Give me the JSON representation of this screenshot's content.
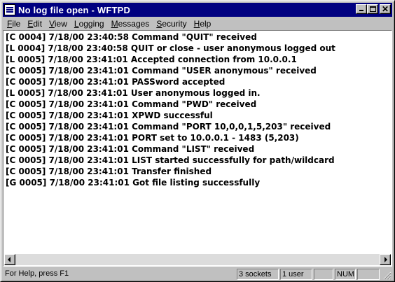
{
  "window": {
    "title": "No log file open - WFTPD"
  },
  "menu": [
    "File",
    "Edit",
    "View",
    "Logging",
    "Messages",
    "Security",
    "Help"
  ],
  "menu_underline": [
    "F",
    "E",
    "V",
    "L",
    "M",
    "S",
    "H"
  ],
  "log": [
    "[C 0004] 7/18/00 23:40:58 Command \"QUIT\" received",
    "[L 0004] 7/18/00 23:40:58 QUIT or close - user anonymous logged out",
    "[L 0005] 7/18/00 23:41:01 Accepted connection from 10.0.0.1",
    "[C 0005] 7/18/00 23:41:01 Command \"USER anonymous\" received",
    "[C 0005] 7/18/00 23:41:01 PASSword accepted",
    "[L 0005] 7/18/00 23:41:01 User anonymous logged in.",
    "[C 0005] 7/18/00 23:41:01 Command \"PWD\" received",
    "[C 0005] 7/18/00 23:41:01 XPWD successful",
    "[C 0005] 7/18/00 23:41:01 Command \"PORT 10,0,0,1,5,203\" received",
    "[C 0005] 7/18/00 23:41:01 PORT set to 10.0.0.1 - 1483 (5,203)",
    "[C 0005] 7/18/00 23:41:01 Command \"LIST\" received",
    "[C 0005] 7/18/00 23:41:01 LIST started successfully for path/wildcard",
    "[C 0005] 7/18/00 23:41:01 Transfer finished",
    "[G 0005] 7/18/00 23:41:01 Got file listing successfully"
  ],
  "status": {
    "help": "For Help, press F1",
    "sockets": "3 sockets",
    "users": "1 user",
    "blank": "",
    "num": "NUM",
    "blank2": ""
  }
}
